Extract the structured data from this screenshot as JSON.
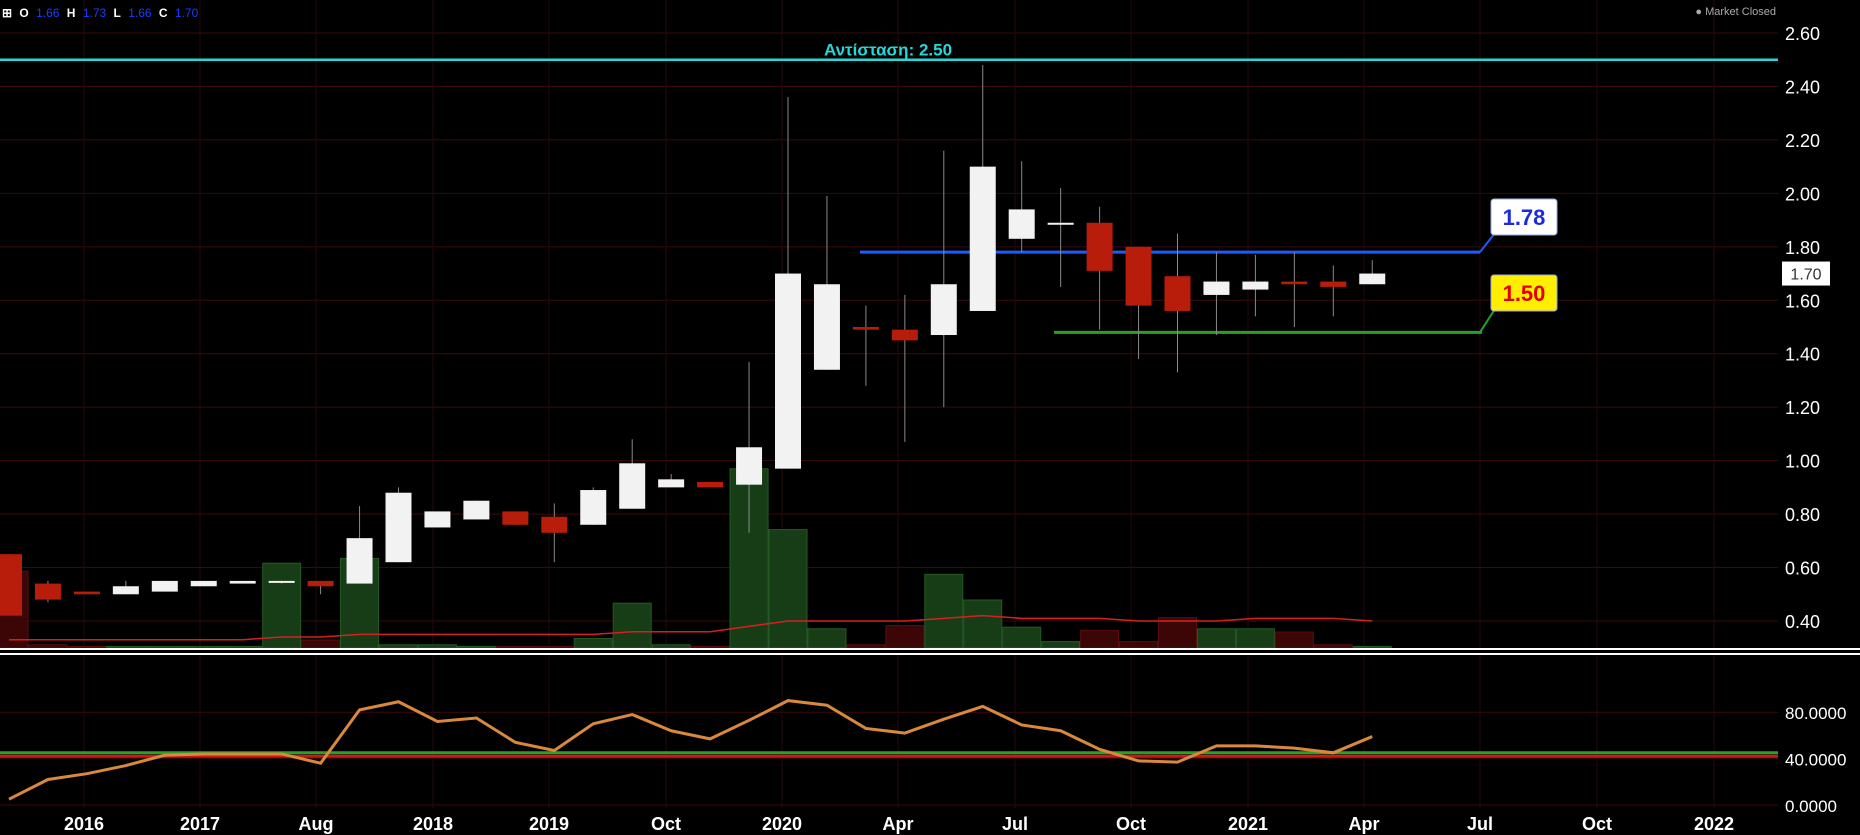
{
  "header": {
    "ohlc": [
      {
        "key": "O",
        "value": "1.66"
      },
      {
        "key": "H",
        "value": "1.73"
      },
      {
        "key": "L",
        "value": "1.66"
      },
      {
        "key": "C",
        "value": "1.70"
      }
    ],
    "market_status": "● Market Closed"
  },
  "colors": {
    "up_candle": "#f2f2f2",
    "down_candle": "#b81c0a",
    "resistance": "#26d7d7",
    "support_upper": "#1e5bff",
    "support_lower": "#2aa02a",
    "rsi_line": "#d8893c"
  },
  "chart_data": [
    {
      "type": "candlestick",
      "title": "",
      "x_tick_labels": [
        "2016",
        "2017",
        "Aug",
        "2018",
        "2019",
        "Oct",
        "2020",
        "Apr",
        "Jul",
        "Oct",
        "2021",
        "Apr",
        "Jul",
        "Oct",
        "2022"
      ],
      "y_tick_labels": [
        "2.60",
        "2.40",
        "2.20",
        "2.00",
        "1.80",
        "1.60",
        "1.40",
        "1.20",
        "1.00",
        "0.80",
        "0.60",
        "0.40"
      ],
      "ylim": [
        0.3,
        2.65
      ],
      "last_price": "1.70",
      "candles": [
        {
          "o": 0.65,
          "h": 0.65,
          "l": 0.42,
          "c": 0.42
        },
        {
          "o": 0.54,
          "h": 0.55,
          "l": 0.47,
          "c": 0.48
        },
        {
          "o": 0.51,
          "h": 0.51,
          "l": 0.5,
          "c": 0.5
        },
        {
          "o": 0.5,
          "h": 0.55,
          "l": 0.5,
          "c": 0.53
        },
        {
          "o": 0.51,
          "h": 0.55,
          "l": 0.51,
          "c": 0.55
        },
        {
          "o": 0.53,
          "h": 0.55,
          "l": 0.53,
          "c": 0.55
        },
        {
          "o": 0.54,
          "h": 0.55,
          "l": 0.54,
          "c": 0.55
        },
        {
          "o": 0.55,
          "h": 0.55,
          "l": 0.54,
          "c": 0.55
        },
        {
          "o": 0.55,
          "h": 0.55,
          "l": 0.5,
          "c": 0.53
        },
        {
          "o": 0.54,
          "h": 0.83,
          "l": 0.54,
          "c": 0.71
        },
        {
          "o": 0.62,
          "h": 0.9,
          "l": 0.62,
          "c": 0.88
        },
        {
          "o": 0.75,
          "h": 0.81,
          "l": 0.75,
          "c": 0.81
        },
        {
          "o": 0.78,
          "h": 0.85,
          "l": 0.78,
          "c": 0.85
        },
        {
          "o": 0.81,
          "h": 0.81,
          "l": 0.76,
          "c": 0.76
        },
        {
          "o": 0.79,
          "h": 0.84,
          "l": 0.62,
          "c": 0.73
        },
        {
          "o": 0.76,
          "h": 0.9,
          "l": 0.76,
          "c": 0.89
        },
        {
          "o": 0.82,
          "h": 1.08,
          "l": 0.82,
          "c": 0.99
        },
        {
          "o": 0.9,
          "h": 0.95,
          "l": 0.9,
          "c": 0.93
        },
        {
          "o": 0.92,
          "h": 0.92,
          "l": 0.9,
          "c": 0.9
        },
        {
          "o": 0.91,
          "h": 1.37,
          "l": 0.73,
          "c": 1.05
        },
        {
          "o": 0.97,
          "h": 2.36,
          "l": 0.97,
          "c": 1.7
        },
        {
          "o": 1.34,
          "h": 1.99,
          "l": 1.34,
          "c": 1.66
        },
        {
          "o": 1.5,
          "h": 1.58,
          "l": 1.28,
          "c": 1.49
        },
        {
          "o": 1.49,
          "h": 1.62,
          "l": 1.07,
          "c": 1.45
        },
        {
          "o": 1.47,
          "h": 2.16,
          "l": 1.2,
          "c": 1.66
        },
        {
          "o": 1.56,
          "h": 2.48,
          "l": 1.56,
          "c": 2.1
        },
        {
          "o": 1.83,
          "h": 2.12,
          "l": 1.78,
          "c": 1.94
        },
        {
          "o": 1.89,
          "h": 2.02,
          "l": 1.65,
          "c": 1.89
        },
        {
          "o": 1.89,
          "h": 1.95,
          "l": 1.49,
          "c": 1.71
        },
        {
          "o": 1.8,
          "h": 1.8,
          "l": 1.38,
          "c": 1.58
        },
        {
          "o": 1.69,
          "h": 1.85,
          "l": 1.33,
          "c": 1.56
        },
        {
          "o": 1.62,
          "h": 1.78,
          "l": 1.47,
          "c": 1.67
        },
        {
          "o": 1.64,
          "h": 1.77,
          "l": 1.54,
          "c": 1.67
        },
        {
          "o": 1.67,
          "h": 1.78,
          "l": 1.5,
          "c": 1.66
        },
        {
          "o": 1.67,
          "h": 1.73,
          "l": 1.54,
          "c": 1.65
        },
        {
          "o": 1.66,
          "h": 1.75,
          "l": 1.66,
          "c": 1.7
        }
      ],
      "volume_relative": [
        0.48,
        0.02,
        0.01,
        0.01,
        0.01,
        0.01,
        0.01,
        0.53,
        0.05,
        0.56,
        0.02,
        0.02,
        0.01,
        0.01,
        0.01,
        0.06,
        0.28,
        0.02,
        0.01,
        1.12,
        0.74,
        0.12,
        0.02,
        0.14,
        0.46,
        0.3,
        0.13,
        0.04,
        0.11,
        0.04,
        0.19,
        0.12,
        0.12,
        0.1,
        0.02,
        0.01
      ],
      "volume_ma": [
        0.33,
        0.33,
        0.33,
        0.33,
        0.33,
        0.33,
        0.33,
        0.34,
        0.34,
        0.35,
        0.35,
        0.35,
        0.35,
        0.35,
        0.35,
        0.35,
        0.36,
        0.36,
        0.36,
        0.38,
        0.4,
        0.4,
        0.4,
        0.4,
        0.41,
        0.42,
        0.41,
        0.41,
        0.41,
        0.4,
        0.4,
        0.4,
        0.41,
        0.41,
        0.41,
        0.4
      ],
      "annotations": [
        {
          "label": "Αντίσταση: 2.50",
          "value": 2.5,
          "color": "#26d7d7"
        },
        {
          "label": "1.78",
          "value": 1.78,
          "color": "#1e5bff",
          "box_color": "#ffffff",
          "text_color": "#1d2be0"
        },
        {
          "label": "1.50",
          "value": 1.48,
          "color": "#2aa02a",
          "box_color": "#ffee00",
          "text_color": "#e00000"
        }
      ]
    },
    {
      "type": "line",
      "title": "",
      "y_tick_labels": [
        "80.0000",
        "40.0000",
        "0.0000"
      ],
      "ylim": [
        0,
        100
      ],
      "reference_levels": [
        {
          "value": 45,
          "color": "#2aa02a"
        },
        {
          "value": 42,
          "color": "#d01818"
        }
      ],
      "series": [
        {
          "values": [
            5,
            22,
            27,
            34,
            43,
            44,
            44,
            44,
            36,
            82,
            89,
            72,
            75,
            54,
            47,
            70,
            78,
            64,
            57,
            73,
            90,
            86,
            66,
            62,
            74,
            85,
            69,
            64,
            48,
            38,
            37,
            51,
            51,
            49,
            45,
            59
          ]
        }
      ]
    }
  ]
}
